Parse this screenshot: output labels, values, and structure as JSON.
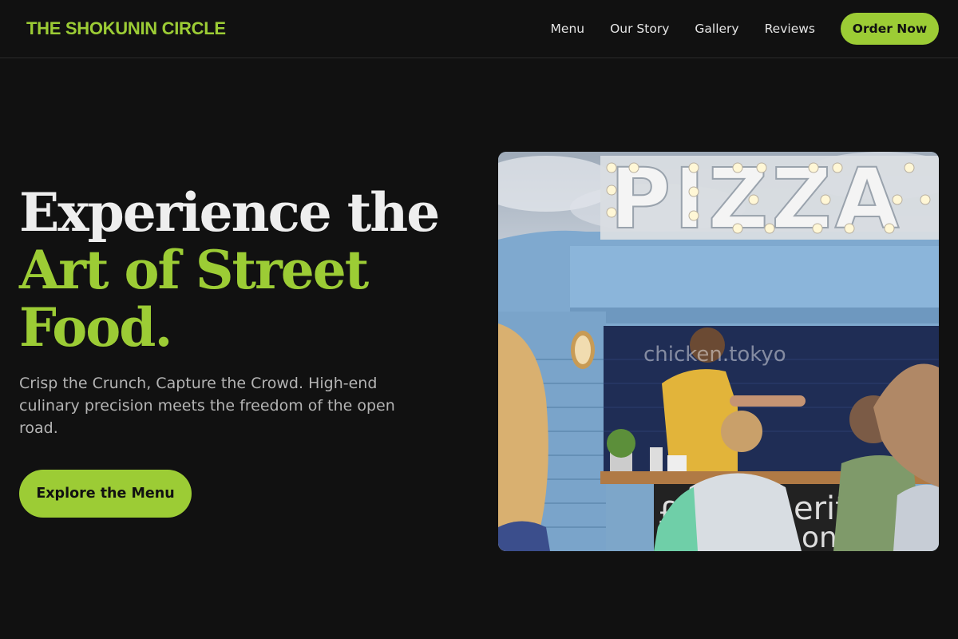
{
  "brand": {
    "name": "THE SHOKUNIN CIRCLE"
  },
  "nav": {
    "links": [
      "Menu",
      "Our Story",
      "Gallery",
      "Reviews"
    ],
    "cta_label": "Order Now"
  },
  "hero": {
    "headline_line1": "Experience the",
    "headline_accent1": "Art of Street",
    "headline_accent2": "Food.",
    "subtitle": "Crisp the Crunch, Capture the Crowd. High-end culinary precision meets the freedom of the open road.",
    "cta_label": "Explore the Menu"
  },
  "photo": {
    "sign_text": "PIZZA",
    "watermark": "chicken.tokyo",
    "chalkboard_text": "£  erit\n   oni"
  },
  "colors": {
    "background": "#111111",
    "accent": "#9ccc35",
    "text": "#eeeeee",
    "muted": "#b4b4b4"
  }
}
